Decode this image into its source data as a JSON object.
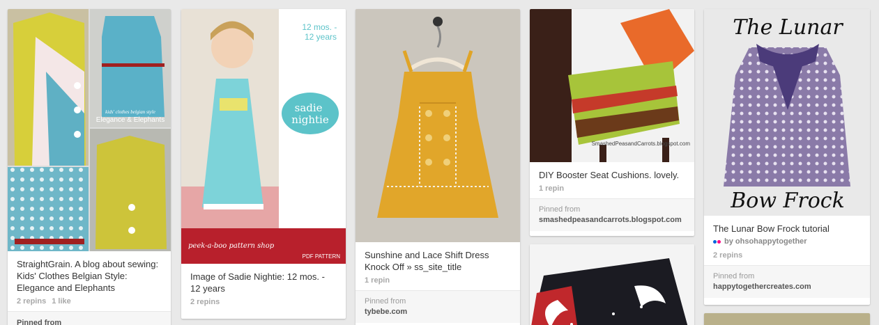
{
  "pins": [
    {
      "description": "StraightGrain. A blog about sewing: Kids' Clothes Belgian Style: Elegance and Elephants",
      "repins": "2 repins",
      "likes": "1 like",
      "overlay_small": "kids' clothes belgian style",
      "overlay_title": "Elegance & Elephants",
      "cut_text": "Pinned from"
    },
    {
      "description": "Image of Sadie Nightie: 12 mos. - 12 years",
      "repins": "2 repins",
      "age_label": "12 mos. -\n12 years",
      "badge": "sadie\nnightie",
      "brand": "peek-a-boo pattern shop",
      "subbrand": "PDF PATTERN"
    },
    {
      "description": "Sunshine and Lace Shift Dress Knock Off » ss_site_title",
      "repins": "1 repin",
      "pinned_from_label": "Pinned from",
      "source": "tybebe.com"
    },
    {
      "description": "DIY Booster Seat Cushions. lovely.",
      "repins": "1 repin",
      "pinned_from_label": "Pinned from",
      "source": "smashedpeasandcarrots.blogspot.com",
      "watermark": "SmashedPeasandCarrots.blogspot.com"
    },
    {
      "description": "The Lunar Bow Frock tutorial",
      "via": "by ohsohappytogether",
      "repins": "2 repins",
      "pinned_from_label": "Pinned from",
      "source": "happytogethercreates.com",
      "title_top": "The Lunar",
      "title_bottom": "Bow Frock"
    }
  ],
  "colors": {
    "background": "#e9e9e9",
    "card": "#ffffff",
    "flickr_blue": "#0063dc",
    "flickr_pink": "#ff0084"
  },
  "icons": [
    "flickr-icon"
  ]
}
